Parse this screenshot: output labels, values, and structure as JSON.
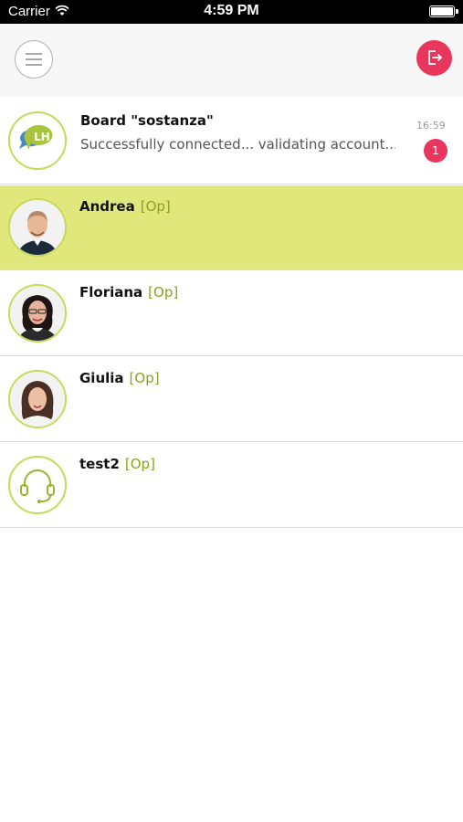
{
  "status_bar": {
    "carrier": "Carrier",
    "time": "4:59 PM"
  },
  "board": {
    "avatar_text": "LH",
    "title": "Board \"sostanza\"",
    "message": "Successfully connected... validating account...",
    "time": "16:59",
    "unread_count": "1"
  },
  "contacts": [
    {
      "name": "Andrea",
      "role": "[Op]"
    },
    {
      "name": "Floriana",
      "role": "[Op]"
    },
    {
      "name": "Giulia",
      "role": "[Op]"
    },
    {
      "name": "test2",
      "role": "[Op]"
    }
  ],
  "colors": {
    "accent": "#c5d95a",
    "active_row": "#e0e87c",
    "role_text": "#8aa21e",
    "badge": "#e8365d"
  }
}
